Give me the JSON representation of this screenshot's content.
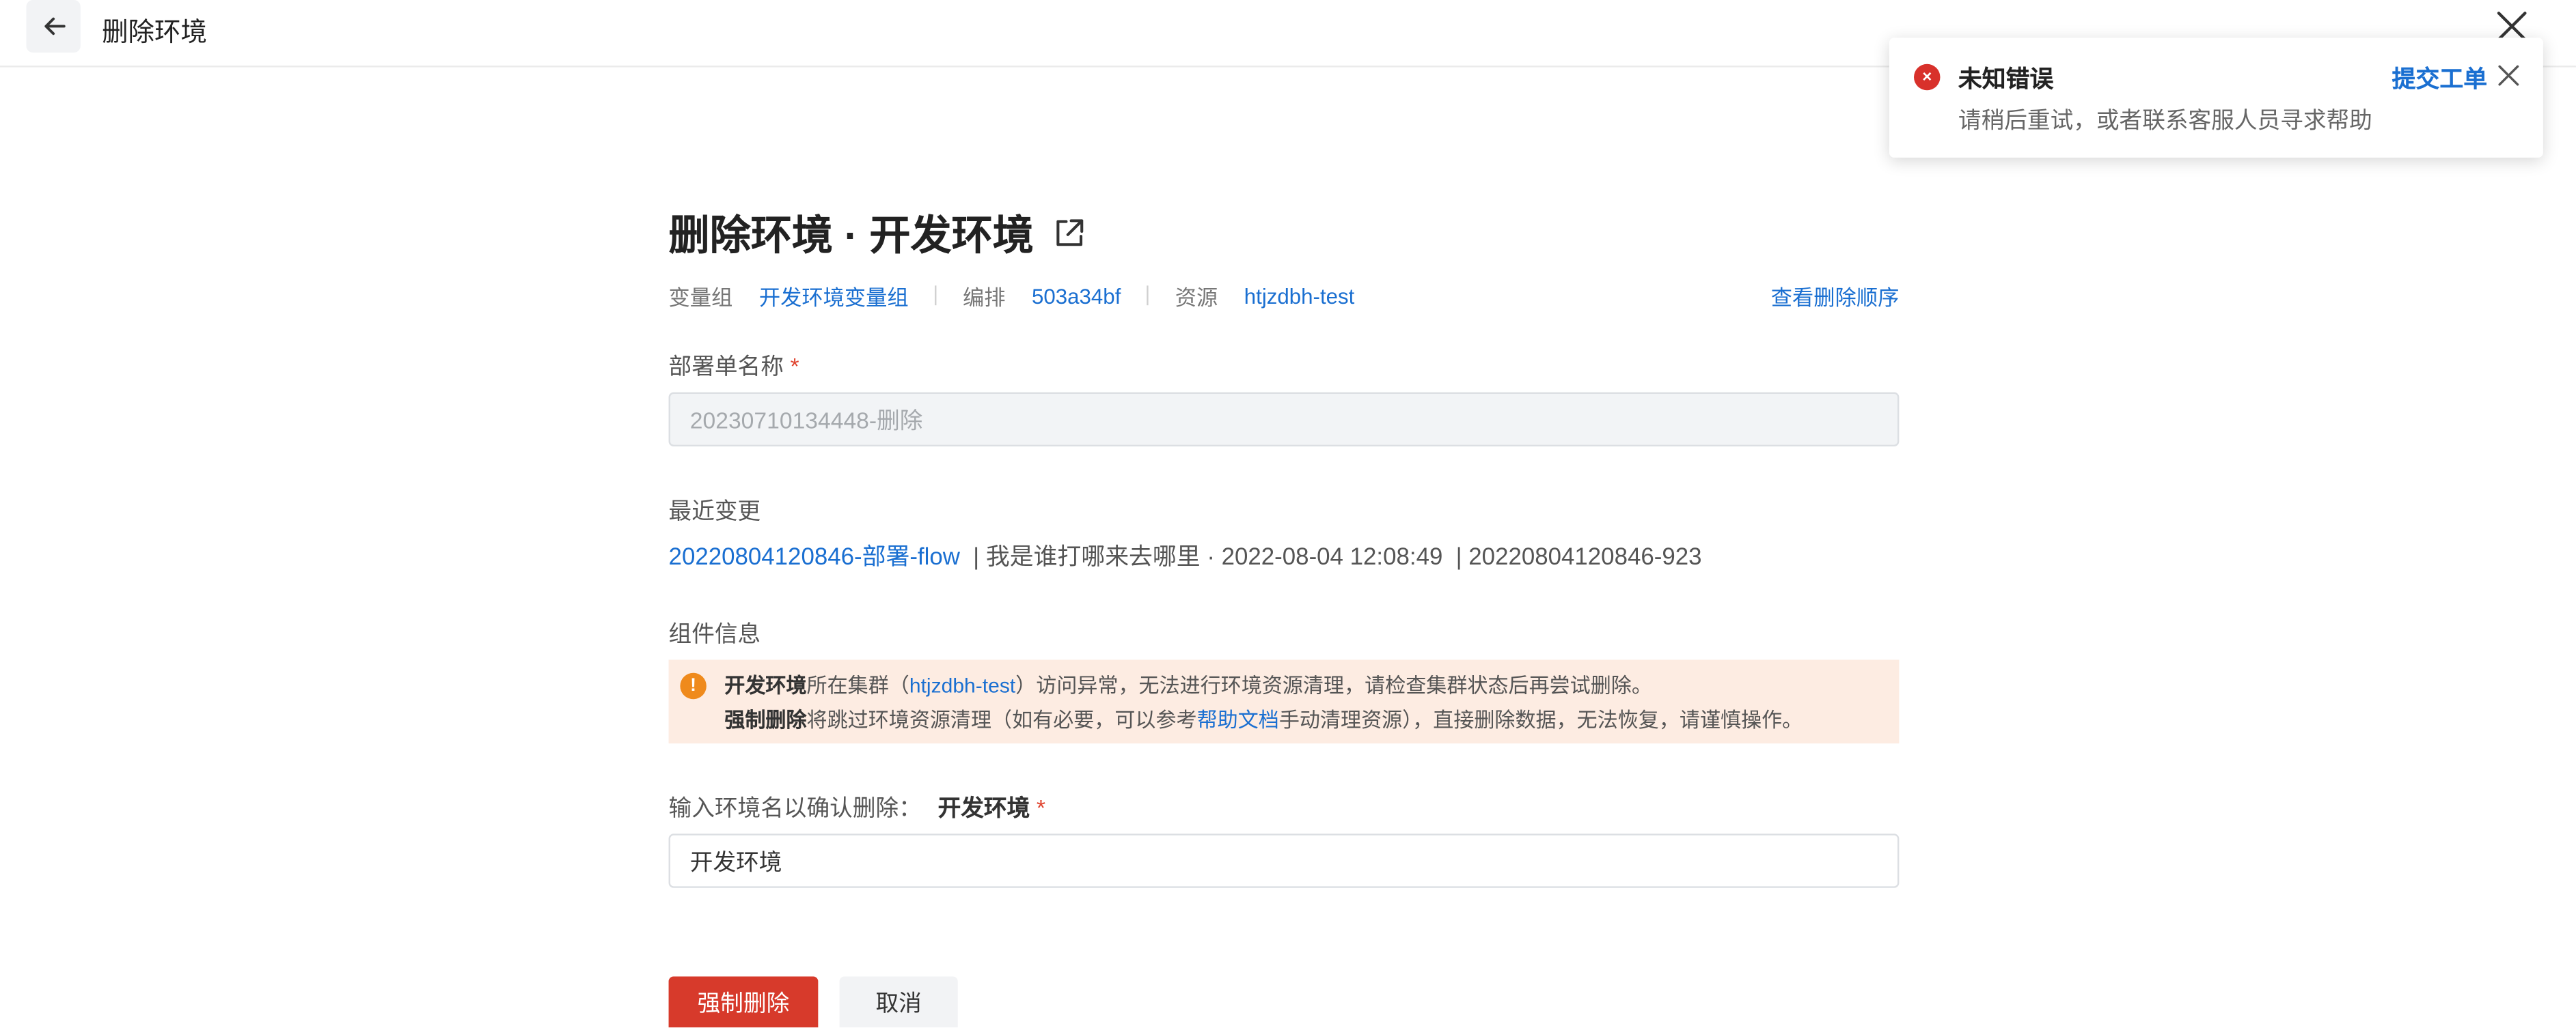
{
  "header": {
    "title": "删除环境"
  },
  "page": {
    "heading": "删除环境 · 开发环境",
    "meta": {
      "var_group_key": "变量组",
      "var_group_value": "开发环境变量组",
      "orchestration_key": "编排",
      "orchestration_value": "503a34bf",
      "resource_key": "资源",
      "resource_value": "htjzdbh-test",
      "view_order_link": "查看删除顺序"
    },
    "deploy_name": {
      "label": "部署单名称",
      "required_mark": "*",
      "value": "20230710134448-删除"
    },
    "recent_change": {
      "label": "最近变更",
      "link": "20220804120846-部署-flow",
      "separator": "|",
      "detail": "我是谁打哪来去哪里 · 2022-08-04 12:08:49",
      "separator2": "|",
      "id": "20220804120846-923"
    },
    "component_info": {
      "label": "组件信息",
      "warn_icon": "!",
      "line1_bold": "开发环境",
      "line1_pre": "所在集群（",
      "line1_link": "htjzdbh-test",
      "line1_post": "）访问异常，无法进行环境资源清理，请检查集群状态后再尝试删除。",
      "line2_bold": "强制删除",
      "line2_pre": "将跳过环境资源清理（如有必要，可以参考",
      "line2_link": "帮助文档",
      "line2_post": "手动清理资源），直接删除数据，无法恢复，请谨慎操作。"
    },
    "confirm": {
      "label": "输入环境名以确认删除：",
      "env_name": "开发环境",
      "required_mark": "*",
      "value": "开发环境"
    },
    "buttons": {
      "force_delete": "强制删除",
      "cancel": "取消"
    }
  },
  "toast": {
    "icon": "×",
    "title": "未知错误",
    "description": "请稍后重试，或者联系客服人员寻求帮助",
    "action": "提交工单"
  },
  "colors": {
    "link": "#1a6fd1",
    "danger": "#d73a2b",
    "warning_bg": "#fdece2",
    "warning_icon": "#ef8a1c",
    "error_icon": "#d8312b"
  }
}
